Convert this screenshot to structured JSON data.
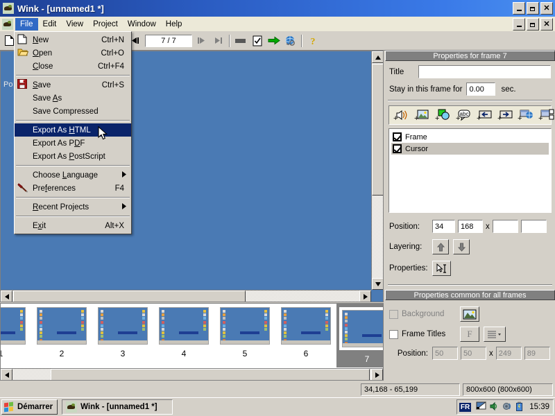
{
  "window": {
    "title": "Wink - [unnamed1 *]",
    "app_icon": "wink-bird-icon",
    "controls": {
      "minimize": "minimize-icon",
      "restore": "restore-icon",
      "close": "close-icon"
    }
  },
  "menubar": {
    "items": [
      {
        "label": "File",
        "active": true
      },
      {
        "label": "Edit",
        "active": false
      },
      {
        "label": "View",
        "active": false
      },
      {
        "label": "Project",
        "active": false
      },
      {
        "label": "Window",
        "active": false
      },
      {
        "label": "Help",
        "active": false
      }
    ]
  },
  "file_menu": {
    "items": [
      {
        "label": "New",
        "accel": "Ctrl+N",
        "icon": "new-document-icon",
        "type": "item",
        "highlighted": false,
        "underline": "N"
      },
      {
        "label": "Open",
        "accel": "Ctrl+O",
        "icon": "open-folder-icon",
        "type": "item",
        "highlighted": false,
        "underline": "O"
      },
      {
        "label": "Close",
        "accel": "Ctrl+F4",
        "icon": "",
        "type": "item",
        "highlighted": false,
        "underline": "C"
      },
      {
        "type": "separator"
      },
      {
        "label": "Save",
        "accel": "Ctrl+S",
        "icon": "save-floppy-icon",
        "type": "item",
        "highlighted": false,
        "underline": "S"
      },
      {
        "label": "Save As",
        "accel": "",
        "icon": "",
        "type": "item",
        "highlighted": false,
        "underline": "A"
      },
      {
        "label": "Save Compressed",
        "accel": "",
        "icon": "",
        "type": "item",
        "highlighted": false,
        "underline": ""
      },
      {
        "type": "separator"
      },
      {
        "label": "Export As HTML",
        "accel": "",
        "icon": "",
        "type": "item",
        "highlighted": true,
        "underline": "H"
      },
      {
        "label": "Export As PDF",
        "accel": "",
        "icon": "",
        "type": "item",
        "highlighted": false,
        "underline": "D"
      },
      {
        "label": "Export As PostScript",
        "accel": "",
        "icon": "",
        "type": "item",
        "highlighted": false,
        "underline": "P"
      },
      {
        "type": "separator"
      },
      {
        "label": "Choose Language",
        "accel": "",
        "icon": "",
        "type": "submenu",
        "highlighted": false,
        "underline": "L"
      },
      {
        "label": "Preferences",
        "accel": "F4",
        "icon": "hammer-icon",
        "type": "item",
        "highlighted": false,
        "underline": "f"
      },
      {
        "type": "separator"
      },
      {
        "label": "Recent Projects",
        "accel": "",
        "icon": "",
        "type": "submenu",
        "highlighted": false,
        "underline": "R"
      },
      {
        "type": "separator"
      },
      {
        "label": "Exit",
        "accel": "Alt+X",
        "icon": "",
        "type": "item",
        "highlighted": false,
        "underline": "x"
      }
    ],
    "submenu_arrow": "▶"
  },
  "toolbar": {
    "buttons": [
      {
        "name": "new-document-icon",
        "title": "New"
      },
      {
        "name": "undo-icon",
        "title": "Undo"
      },
      {
        "name": "cut-scissors-icon",
        "title": "Cut"
      },
      {
        "name": "copy-icon",
        "title": "Copy"
      },
      {
        "name": "paste-icon",
        "title": "Paste"
      },
      {
        "name": "first-frame-icon",
        "title": "First frame"
      },
      {
        "name": "previous-frame-icon",
        "title": "Previous frame"
      },
      {
        "name": "next-frame-icon",
        "title": "Next frame"
      },
      {
        "name": "last-frame-icon",
        "title": "Last frame"
      },
      {
        "name": "render-icon",
        "title": "Render"
      },
      {
        "name": "validate-icon",
        "title": "Validate"
      },
      {
        "name": "export-arrow-icon",
        "title": "Export"
      },
      {
        "name": "browser-preview-icon",
        "title": "Preview in browser"
      },
      {
        "name": "help-icon",
        "title": "Help"
      }
    ],
    "frame_counter": "7 / 7"
  },
  "canvas": {
    "partial_label": "Po",
    "background_color": "#4a7ab4"
  },
  "frame_properties": {
    "header": "Properties for frame 7",
    "title_label": "Title",
    "title_value": "",
    "stay_label": "Stay in this frame for",
    "stay_value": "0.00",
    "stay_unit": "sec.",
    "add_buttons": [
      {
        "name": "add-sound-icon"
      },
      {
        "name": "add-image-icon"
      },
      {
        "name": "add-shape-icon"
      },
      {
        "name": "add-textbox-icon"
      },
      {
        "name": "add-left-button-icon"
      },
      {
        "name": "add-right-button-icon"
      },
      {
        "name": "add-browser-link-icon"
      },
      {
        "name": "add-new-window-icon"
      }
    ],
    "objects": [
      {
        "label": "Frame",
        "checked": true,
        "selected": false
      },
      {
        "label": "Cursor",
        "checked": true,
        "selected": true
      }
    ],
    "position_label": "Position:",
    "position_x": "34",
    "position_y": "168",
    "position_sep": "x",
    "position_w": "",
    "position_h": "",
    "layering_label": "Layering:",
    "layer_up_icon": "arrow-up-icon",
    "layer_down_icon": "arrow-down-icon",
    "properties_label": "Properties:",
    "properties_icon": "cursor-text-properties-icon"
  },
  "common_properties": {
    "header": "Properties common for all frames",
    "background_label": "Background",
    "background_checked": false,
    "background_disabled": true,
    "background_icon": "image-icon",
    "frame_titles_label": "Frame Titles",
    "frame_titles_checked": false,
    "font_button_label": "F",
    "align_icon": "align-dropdown-icon",
    "position_label": "Position:",
    "position_x": "50",
    "position_y": "50",
    "position_sep": "x",
    "position_w": "249",
    "position_h": "89"
  },
  "filmstrip": {
    "frames": [
      {
        "number": "1",
        "selected": false,
        "partial": true
      },
      {
        "number": "2",
        "selected": false,
        "partial": false
      },
      {
        "number": "3",
        "selected": false,
        "partial": false
      },
      {
        "number": "4",
        "selected": false,
        "partial": false
      },
      {
        "number": "5",
        "selected": false,
        "partial": false
      },
      {
        "number": "6",
        "selected": false,
        "partial": false
      },
      {
        "number": "7",
        "selected": true,
        "partial": false
      }
    ]
  },
  "statusbar": {
    "coords": "34,168 - 65,199",
    "dimensions": "800x600 (800x600)"
  },
  "taskbar": {
    "start_label": "Démarrer",
    "start_icon": "windows-logo-icon",
    "items": [
      {
        "label": "Wink - [unnamed1 *]",
        "icon": "wink-bird-icon",
        "active": true
      }
    ],
    "tray": {
      "language": "FR",
      "icons": [
        "display-properties-icon",
        "volume-mute-icon",
        "speaker-icon",
        "battery-icon"
      ],
      "time": "15:39"
    }
  }
}
